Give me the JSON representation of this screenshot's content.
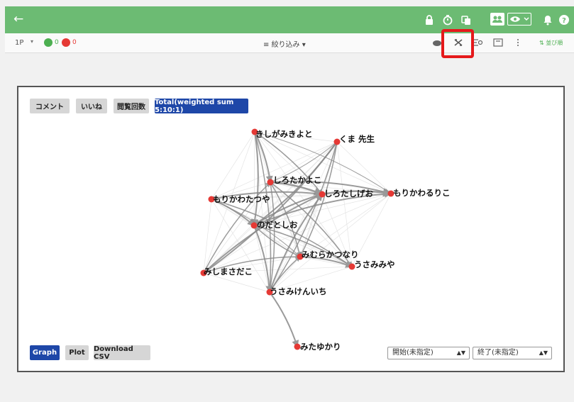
{
  "topbar": {
    "bg_color": "#6cbb73",
    "icons": [
      "back-arrow-icon",
      "lock-icon",
      "timer-icon",
      "copy-icon",
      "group-icon",
      "eye-icon",
      "bell-icon",
      "help-icon"
    ]
  },
  "toolbar": {
    "page_label": "1P",
    "good_count": "0",
    "bad_count": "0",
    "filter_label": "絞り込み",
    "sort_label": "並び順",
    "good_color": "#4caf50",
    "bad_color": "#e53935"
  },
  "panel": {
    "metric_tabs": [
      {
        "label": "コメント",
        "active": false
      },
      {
        "label": "いいね",
        "active": false
      },
      {
        "label": "閲覧回数",
        "active": false
      },
      {
        "label": "Total(weighted sum 5:10:1)",
        "active": true
      }
    ],
    "view_buttons": [
      {
        "label": "Graph",
        "active": true
      },
      {
        "label": "Plot",
        "active": false
      },
      {
        "label": "Download CSV",
        "active": false
      }
    ],
    "start_select": "開始(未指定)",
    "end_select": "終了(未指定)",
    "active_color": "#1e47a8",
    "node_color": "#e53935"
  },
  "graph": {
    "nodes": [
      {
        "id": "kishigami",
        "label": "きしがみきよと"
      },
      {
        "id": "kuma",
        "label": "くま 先生"
      },
      {
        "id": "shirotaka",
        "label": "しろたかよこ"
      },
      {
        "id": "shirotashi",
        "label": "しろたしげお"
      },
      {
        "id": "morikawaru",
        "label": "もりかわるりこ"
      },
      {
        "id": "morikawata",
        "label": "もりかわたつや"
      },
      {
        "id": "noda",
        "label": "のだとしお"
      },
      {
        "id": "mimura",
        "label": "みむらかつなり"
      },
      {
        "id": "usamimiya",
        "label": "うさみみや"
      },
      {
        "id": "mishima",
        "label": "みしまさだこ"
      },
      {
        "id": "usamiken",
        "label": "うさみけんいち"
      },
      {
        "id": "mitayukari",
        "label": "みたゆかり"
      }
    ]
  }
}
